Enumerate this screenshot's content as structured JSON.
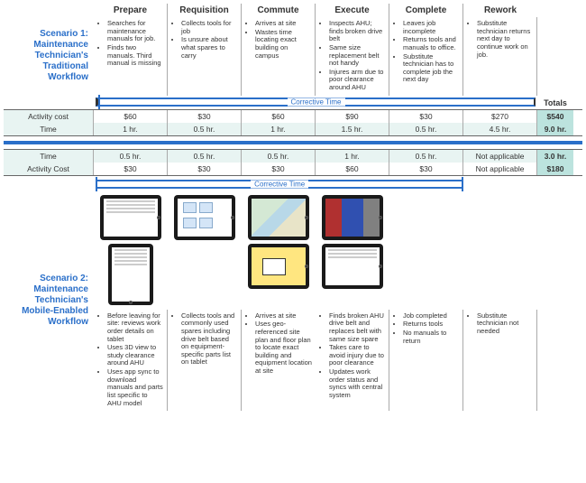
{
  "phases": [
    "Prepare",
    "Requisition",
    "Commute",
    "Execute",
    "Complete",
    "Rework"
  ],
  "scenario1": {
    "label": "Scenario 1: Maintenance Technician's Traditional Workflow",
    "bullets": {
      "prepare": [
        "Searches for maintenance manuals for job.",
        "Finds two manuals. Third manual is missing"
      ],
      "requisition": [
        "Collects tools for job",
        "Is unsure about what spares to carry"
      ],
      "commute": [
        "Arrives at site",
        "Wastes time locating exact building on campus"
      ],
      "execute": [
        "Inspects AHU; finds broken drive belt",
        "Same size replacement belt not handy",
        "Injures arm due to poor clearance around AHU"
      ],
      "complete": [
        "Leaves job incomplete",
        "Returns tools and manuals to office.",
        "Substitute technician has to complete job the next day"
      ],
      "rework": [
        "Substitute technician returns next day to continue work on job."
      ]
    },
    "corrective_label": "Corrective Time",
    "totals_label": "Totals",
    "metrics": {
      "activity_cost_label": "Activity cost",
      "time_label": "Time",
      "activity_cost": [
        "$60",
        "$30",
        "$60",
        "$90",
        "$30",
        "$270"
      ],
      "time": [
        "1 hr.",
        "0.5 hr.",
        "1 hr.",
        "1.5 hr.",
        "0.5 hr.",
        "4.5 hr."
      ],
      "total_cost": "$540",
      "total_time": "9.0 hr."
    }
  },
  "scenario2": {
    "label": "Scenario 2: Maintenance Technician's Mobile-Enabled Workflow",
    "corrective_label": "Corrective Time",
    "metrics": {
      "time_label": "Time",
      "activity_cost_label": "Activity Cost",
      "time": [
        "0.5 hr.",
        "0.5 hr.",
        "0.5 hr.",
        "1 hr.",
        "0.5 hr.",
        "Not applicable"
      ],
      "activity_cost": [
        "$30",
        "$30",
        "$30",
        "$60",
        "$30",
        "Not applicable"
      ],
      "total_time": "3.0 hr.",
      "total_cost": "$180"
    },
    "bullets": {
      "prepare": [
        "Before leaving for site: reviews work order details on tablet",
        "Uses 3D view to study clearance around AHU",
        "Uses app sync to download manuals and parts list specific to AHU model"
      ],
      "requisition": [
        "Collects tools and commonly used spares including drive belt based on equipment-specific parts list on tablet"
      ],
      "commute": [
        "Arrives at site",
        "Uses geo-referenced site plan and floor plan to locate exact building and equipment location at site"
      ],
      "execute": [
        "Finds broken AHU drive belt and replaces belt with same size spare",
        "Takes care to avoid injury due to poor clearance",
        "Updates work order status and syncs with central system"
      ],
      "complete": [
        "Job completed",
        "Returns tools",
        "No manuals to return"
      ],
      "rework": [
        "Substitute technician not needed"
      ]
    }
  }
}
